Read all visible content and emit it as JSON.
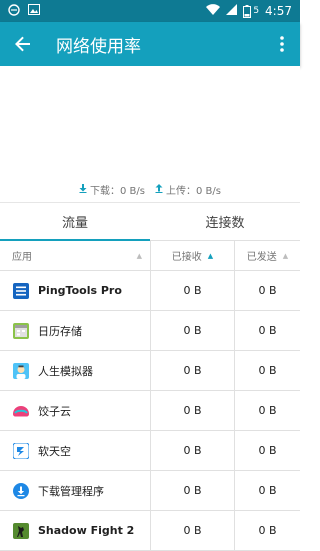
{
  "status_bar": {
    "time": "4:57",
    "battery_level_text": "5",
    "icons": [
      "edge-browser-icon",
      "image-icon",
      "wifi-icon",
      "signal-icon",
      "battery-icon"
    ]
  },
  "toolbar": {
    "title": "网络使用率",
    "back_icon": "back-arrow-icon",
    "menu_icon": "more-vert-icon"
  },
  "speed": {
    "download": "下载：0 B/s",
    "upload": "上传：0 B/s"
  },
  "tabs": [
    {
      "label": "流量",
      "active": true
    },
    {
      "label": "连接数",
      "active": false
    }
  ],
  "table": {
    "headers": {
      "app": "应用",
      "received": "已接收",
      "sent": "已发送"
    },
    "rows": [
      {
        "name": "PingTools Pro",
        "received": "0 B",
        "sent": "0 B",
        "icon": "pingtools-icon"
      },
      {
        "name": "日历存储",
        "received": "0 B",
        "sent": "0 B",
        "icon": "calendar-storage-icon"
      },
      {
        "name": "人生模拟器",
        "received": "0 B",
        "sent": "0 B",
        "icon": "life-simulator-icon"
      },
      {
        "name": "饺子云",
        "received": "0 B",
        "sent": "0 B",
        "icon": "jiaozi-cloud-icon"
      },
      {
        "name": "软天空",
        "received": "0 B",
        "sent": "0 B",
        "icon": "ruantiankong-icon"
      },
      {
        "name": "下载管理程序",
        "received": "0 B",
        "sent": "0 B",
        "icon": "download-manager-icon"
      },
      {
        "name": "Shadow Fight 2",
        "received": "0 B",
        "sent": "0 B",
        "icon": "shadow-fight-icon"
      }
    ]
  },
  "colors": {
    "status_bar": "#0e7a93",
    "toolbar": "#14a0bd",
    "accent": "#14a0bd"
  }
}
